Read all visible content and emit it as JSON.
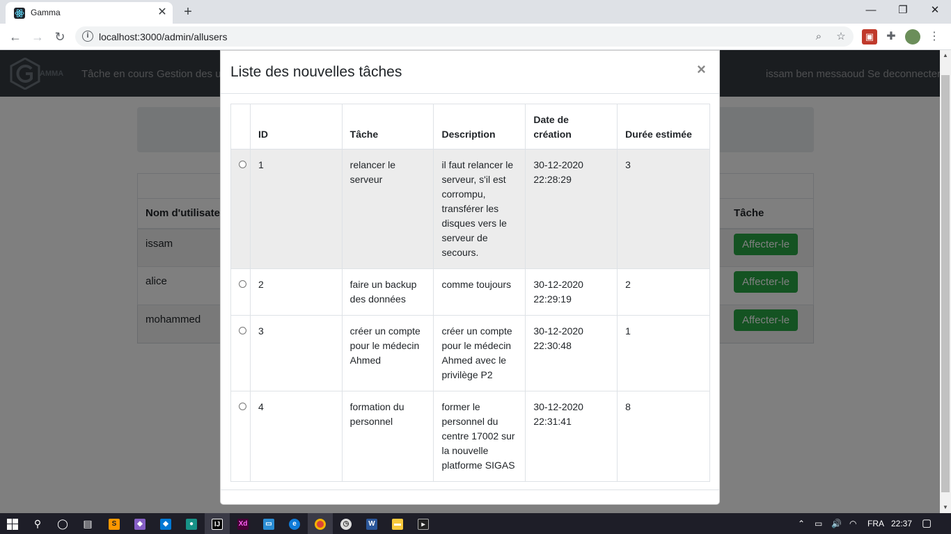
{
  "browser": {
    "tab_title": "Gamma",
    "url": "localhost:3000/admin/allusers",
    "window_controls": [
      "—",
      "❐",
      "✕"
    ]
  },
  "navbar": {
    "brand": "AMMA",
    "links": [
      "Tâche en cours",
      "Gestion des ut"
    ],
    "user": "issam ben messaoud",
    "logout": "Se deconnecter"
  },
  "users_table": {
    "headers": [
      "Nom d'utilisateur",
      "Tâche"
    ],
    "rows": [
      {
        "name": "issam",
        "action": "Affecter-le"
      },
      {
        "name": "alice",
        "action": "Affecter-le"
      },
      {
        "name": "mohammed",
        "action": "Affecter-le"
      }
    ]
  },
  "modal": {
    "title": "Liste des nouvelles tâches",
    "close": "×",
    "headers": [
      "",
      "ID",
      "Tâche",
      "Description",
      "Date de création",
      "Durée estimée"
    ],
    "rows": [
      {
        "id": "1",
        "task": "relancer le serveur",
        "description": "il faut relancer le serveur, s'il est corrompu, transférer les disques vers le serveur de secours.",
        "date": "30-12-2020 22:28:29",
        "duration": "3"
      },
      {
        "id": "2",
        "task": "faire un backup des données",
        "description": "comme toujours",
        "date": "30-12-2020 22:29:19",
        "duration": "2"
      },
      {
        "id": "3",
        "task": "créer un compte pour le médecin Ahmed",
        "description": "créer un compte pour le médecin Ahmed avec le privilège P2",
        "date": "30-12-2020 22:30:48",
        "duration": "1"
      },
      {
        "id": "4",
        "task": "formation du personnel",
        "description": "former le personnel du centre 17002 sur la nouvelle platforme SIGAS",
        "date": "30-12-2020 22:31:41",
        "duration": "8"
      }
    ]
  },
  "taskbar": {
    "apps": [
      "sublime-text",
      "visual-studio",
      "vscode",
      "gitkraken",
      "intellij",
      "adobe-xd",
      "remote-desktop",
      "edge",
      "chrome",
      "clock",
      "word",
      "file-explorer",
      "terminal"
    ],
    "language": "FRA",
    "time": "22:37"
  },
  "colors": {
    "navbar": "#343a40",
    "success": "#28a745",
    "highlight_row": "#ececec"
  }
}
